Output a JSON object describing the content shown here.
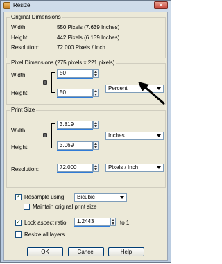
{
  "window": {
    "title": "Resize",
    "close_label": "✕"
  },
  "original_dimensions": {
    "title": "Original Dimensions",
    "width_label": "Width:",
    "width_value": "550 Pixels (7.639 Inches)",
    "height_label": "Height:",
    "height_value": "442 Pixels (6.139 Inches)",
    "resolution_label": "Resolution:",
    "resolution_value": "72.000 Pixels / Inch"
  },
  "pixel_dimensions": {
    "title": "Pixel Dimensions (275 pixels x 221 pixels)",
    "width_label": "Width:",
    "width_value": "50",
    "height_label": "Height:",
    "height_value": "50",
    "unit_selected": "Percent"
  },
  "print_size": {
    "title": "Print Size",
    "width_label": "Width:",
    "width_value": "3.819",
    "height_label": "Height:",
    "height_value": "3.069",
    "unit_selected": "Inches",
    "resolution_label": "Resolution:",
    "resolution_value": "72.000",
    "resolution_unit_selected": "Pixels / Inch"
  },
  "options": {
    "resample_label": "Resample using:",
    "resample_checked": true,
    "resample_method": "Bicubic",
    "maintain_label": "Maintain original print size",
    "maintain_checked": false,
    "lock_label": "Lock aspect ratio:",
    "lock_checked": true,
    "ratio_value": "1.2443",
    "ratio_suffix": "to 1",
    "resize_all_label": "Resize all layers",
    "resize_all_checked": false
  },
  "buttons": {
    "ok": "OK",
    "cancel": "Cancel",
    "help": "Help"
  },
  "colors": {
    "accent": "#2f7bd8",
    "client_bg": "#ece9d8"
  }
}
